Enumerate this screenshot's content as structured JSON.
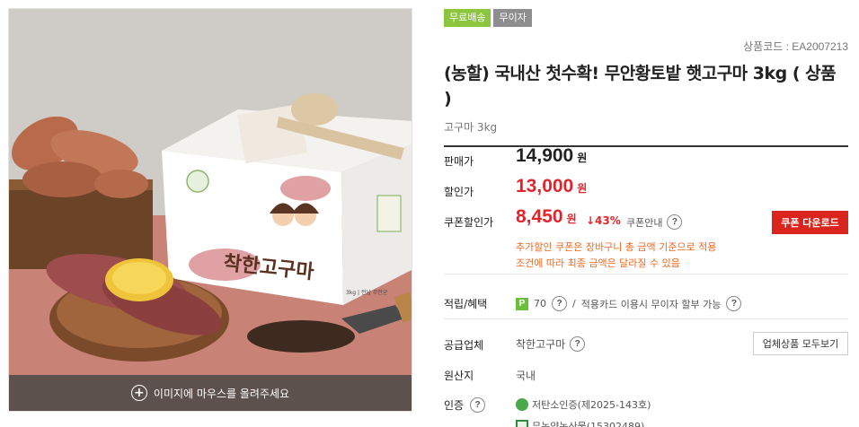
{
  "image_panel": {
    "hover_hint": "이미지에 마우스를 올려주세요",
    "box_brand": "착한고구마",
    "box_sub": "3kg | 전남 무안군"
  },
  "badges": [
    "무료배송",
    "무이자"
  ],
  "product": {
    "code": "상품코드 : EA2007213",
    "title": "(농할) 국내산 첫수확! 무안황토밭 햇고구마 3kg ( 상품 )",
    "subtitle": "고구마 3kg"
  },
  "prices": {
    "sale_label": "판매가",
    "sale_value": "14,900",
    "discount_label": "할인가",
    "discount_value": "13,000",
    "coupon_label": "쿠폰할인가",
    "coupon_value": "8,450",
    "currency": "원",
    "drop_pct": "↓43%",
    "coupon_info": "쿠폰안내",
    "coupon_button": "쿠폰 다운로드",
    "notes": [
      "추가할인 쿠폰은 장바구니 총 금액 기준으로 적용",
      "조건에 따라 최종 금액은 달라질 수 있음"
    ]
  },
  "benefits": {
    "label": "적립/혜택",
    "points_icon": "P",
    "points": "70",
    "separator": "/",
    "card_text": "적용카드 이용시 무이자 할부 가능"
  },
  "supplier": {
    "label": "공급업체",
    "name": "착한고구마",
    "button": "업체상품 모두보기"
  },
  "origin": {
    "label": "원산지",
    "value": "국내"
  },
  "certification": {
    "label": "인증",
    "items": [
      "저탄소인증(제2025-143호)",
      "무농약농산물(15302489)"
    ]
  },
  "help_glyph": "?",
  "plus_glyph": "+",
  "colors": {
    "free_shipping_badge": "#8cc63f",
    "interest_free_badge": "#8e8e8e",
    "discount_red": "#e0262c",
    "coupon_button": "#d9251d",
    "note_orange": "#f0681f"
  }
}
